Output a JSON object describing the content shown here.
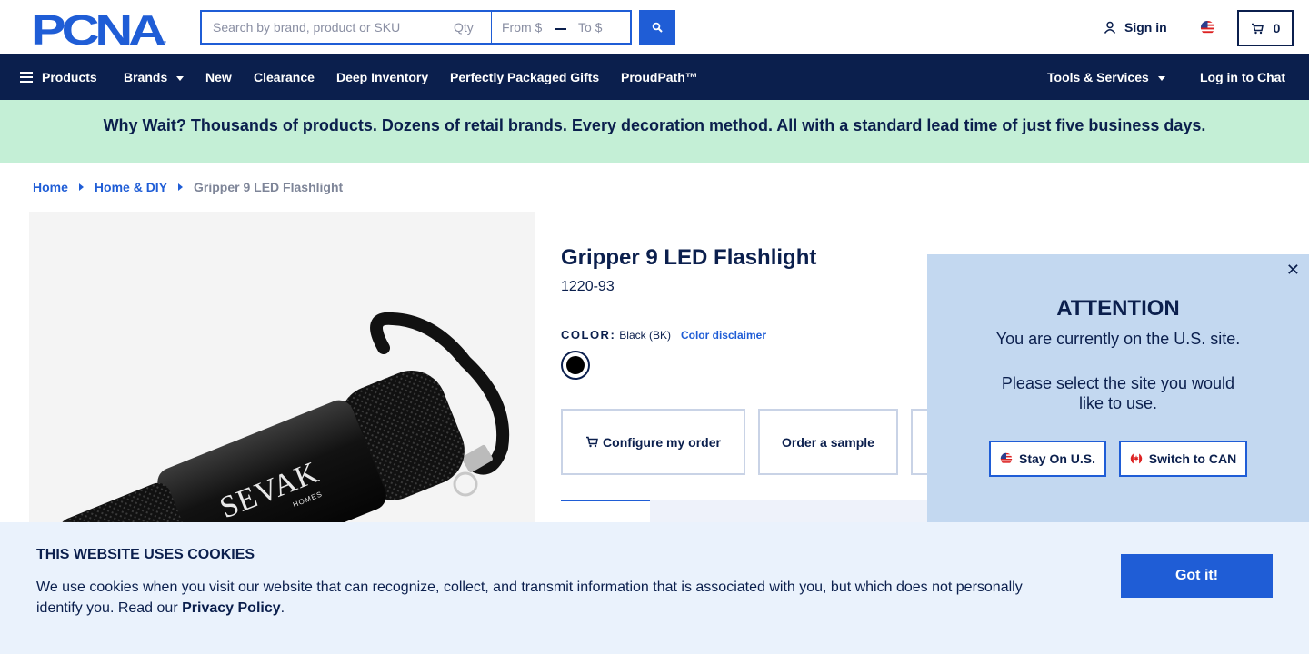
{
  "header": {
    "logo_text": "PCNA",
    "search_placeholder": "Search by brand, product or SKU",
    "qty_placeholder": "Qty",
    "from_placeholder": "From $",
    "to_placeholder": "To $",
    "signin_label": "Sign in",
    "cart_count": "0"
  },
  "nav": {
    "products": "Products",
    "brands": "Brands",
    "new": "New",
    "clearance": "Clearance",
    "deep_inventory": "Deep Inventory",
    "gifts": "Perfectly Packaged Gifts",
    "proudpath": "ProudPath™",
    "tools": "Tools & Services",
    "chat": "Log in to Chat"
  },
  "banner": {
    "text": "Why Wait? Thousands of products. Dozens of retail brands. Every decoration method. All with a standard lead time of just five business days."
  },
  "breadcrumb": {
    "home": "Home",
    "category": "Home & DIY",
    "current": "Gripper 9 LED Flashlight"
  },
  "product": {
    "title": "Gripper 9 LED Flashlight",
    "sku": "1220-93",
    "color_label": "COLOR:",
    "color_value": "Black (BK)",
    "color_disclaimer": "Color disclaimer",
    "swatch_color": "#000000",
    "image_brand_text": "SEVAK",
    "image_brand_subtext": "HOMES",
    "configure_label": "Configure my order",
    "sample_label": "Order a sample"
  },
  "attention": {
    "title": "ATTENTION",
    "line1": "You are currently on the U.S. site.",
    "line2": "Please select the site you would",
    "line3": "like to use.",
    "stay_label": "Stay On U.S.",
    "switch_label": "Switch to CAN"
  },
  "cookie": {
    "title": "THIS WEBSITE USES COOKIES",
    "text": "We use cookies when you visit our website that can recognize, collect, and transmit information that is associated with you, but which does not personally identify you. Read our",
    "link": "Privacy Policy",
    "period": ".",
    "button": "Got it!"
  },
  "colors": {
    "navy": "#0b1f4d",
    "accent_blue": "#1f5dd6",
    "banner_green": "#c4efd6",
    "popup_blue": "#c3d8f0",
    "cookie_bg": "#eaf2fc"
  }
}
